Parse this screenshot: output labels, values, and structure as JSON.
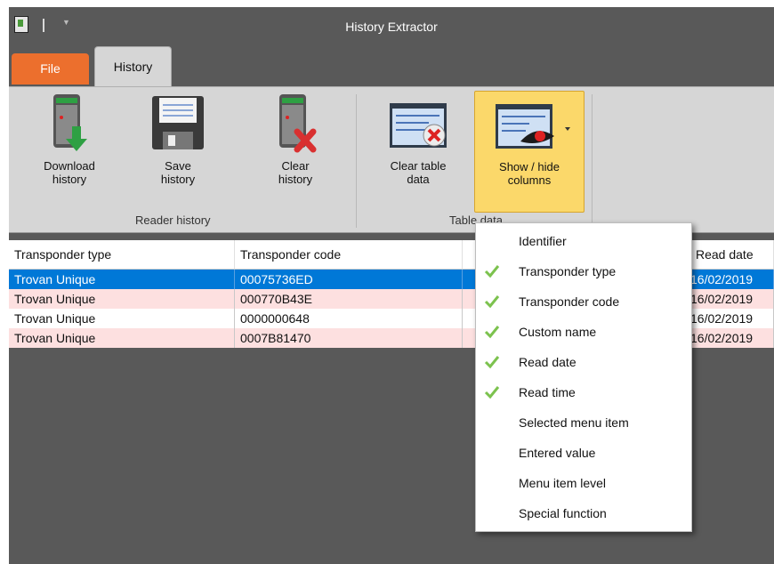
{
  "window": {
    "title": "History Extractor"
  },
  "tabs": [
    {
      "label": "File"
    },
    {
      "label": "History"
    }
  ],
  "ribbon": {
    "buttons": [
      {
        "label1": "Download",
        "label2": "history",
        "icon": "download-device-icon"
      },
      {
        "label1": "Save",
        "label2": "history",
        "icon": "floppy-disk-icon"
      },
      {
        "label1": "Clear",
        "label2": "history",
        "icon": "clear-device-icon"
      },
      {
        "label1": "Clear table",
        "label2": "data",
        "icon": "clear-table-icon"
      },
      {
        "label1": "Show / hide",
        "label2": "columns",
        "icon": "eye-table-icon"
      }
    ],
    "groups": [
      {
        "label": "Reader history"
      },
      {
        "label": "Table data"
      }
    ]
  },
  "table": {
    "columns": [
      "Transponder type",
      "Transponder code",
      "",
      "Read date"
    ],
    "rows": [
      {
        "type": "Trovan Unique",
        "code": "00075736ED",
        "date": "16/02/2019",
        "state": "selected"
      },
      {
        "type": "Trovan Unique",
        "code": "000770B43E",
        "date": "16/02/2019",
        "state": "pink"
      },
      {
        "type": "Trovan Unique",
        "code": "0000000648",
        "date": "16/02/2019",
        "state": "white"
      },
      {
        "type": "Trovan Unique",
        "code": "0007B81470",
        "date": "16/02/2019",
        "state": "pink"
      }
    ]
  },
  "menu": {
    "items": [
      {
        "label": "Identifier",
        "checked": false
      },
      {
        "label": "Transponder type",
        "checked": true
      },
      {
        "label": "Transponder code",
        "checked": true
      },
      {
        "label": "Custom name",
        "checked": true
      },
      {
        "label": "Read date",
        "checked": true
      },
      {
        "label": "Read time",
        "checked": true
      },
      {
        "label": "Selected menu item",
        "checked": false
      },
      {
        "label": "Entered value",
        "checked": false
      },
      {
        "label": "Menu item level",
        "checked": false
      },
      {
        "label": "Special function",
        "checked": false
      }
    ]
  },
  "colors": {
    "file_tab": "#ec6f2d",
    "selection": "#0078d7",
    "row_pink": "#fde0e0",
    "active_button": "#fbd86a",
    "check": "#7cc24e"
  }
}
